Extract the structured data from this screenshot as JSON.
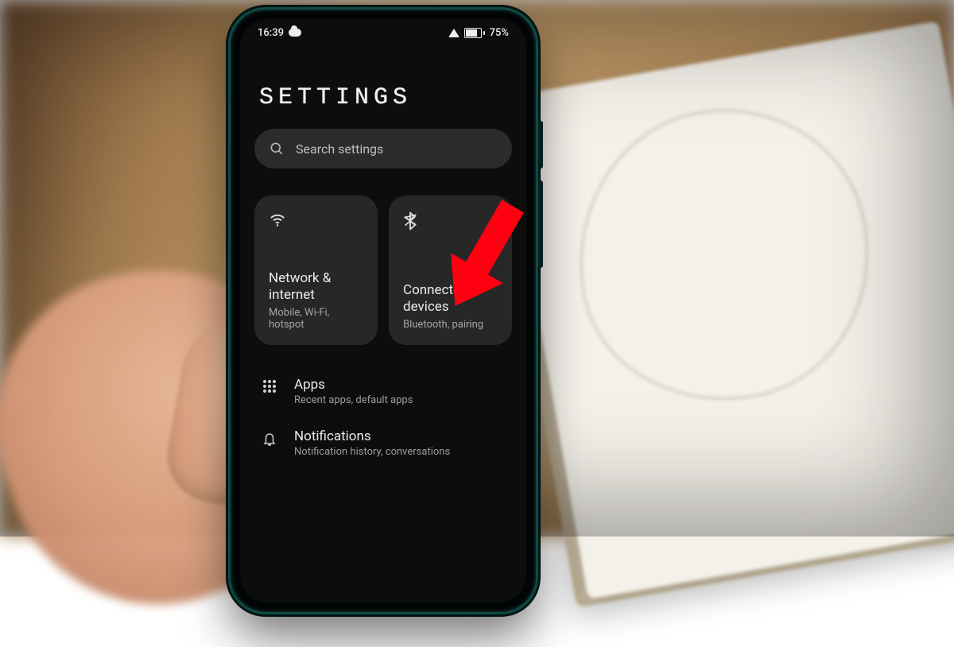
{
  "status": {
    "time": "16:39",
    "battery": "75%"
  },
  "header": {
    "title": "SETTINGS"
  },
  "search": {
    "placeholder": "Search settings"
  },
  "cards": [
    {
      "title": "Network & internet",
      "subtitle": "Mobile, Wi-Fi, hotspot"
    },
    {
      "title": "Connected devices",
      "subtitle": "Bluetooth, pairing"
    }
  ],
  "rows": [
    {
      "title": "Apps",
      "subtitle": "Recent apps, default apps"
    },
    {
      "title": "Notifications",
      "subtitle": "Notification history, conversations"
    }
  ],
  "annotation": {
    "target": "connected-devices-card",
    "style": "red-arrow"
  }
}
